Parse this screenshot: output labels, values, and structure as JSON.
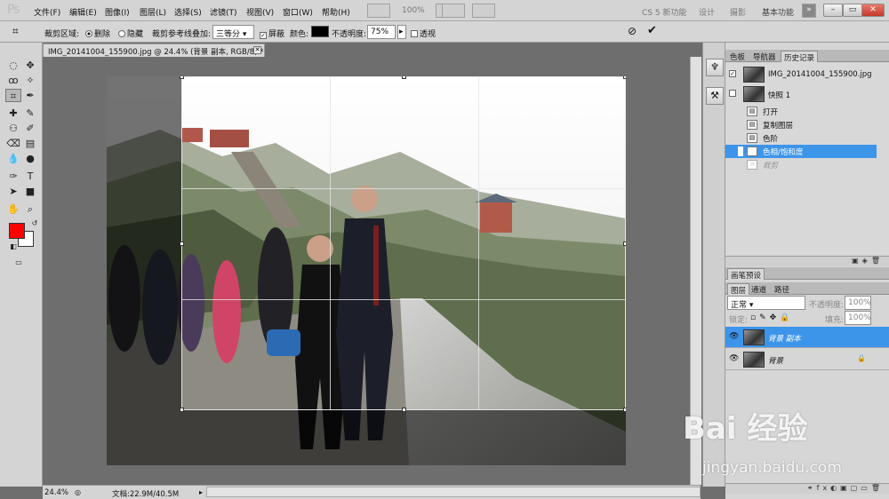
{
  "app": {
    "logo": "Ps"
  },
  "menu": [
    "文件(F)",
    "编辑(E)",
    "图像(I)",
    "图层(L)",
    "选择(S)",
    "滤镜(T)",
    "视图(V)",
    "窗口(W)",
    "帮助(H)"
  ],
  "menubar_extra": {
    "zoom": "100%"
  },
  "workspaces": [
    "CS 5 新功能",
    "设计",
    "摄影",
    "基本功能"
  ],
  "options": {
    "crop_area_label": "裁剪区域:",
    "delete_label": "删除",
    "hide_label": "隐藏",
    "overlay_label": "裁剪参考线叠加:",
    "overlay_value": "三等分",
    "shield_label": "屏蔽",
    "color_label": "颜色:",
    "opacity_label": "不透明度:",
    "opacity_value": "75%",
    "perspective_label": "透视",
    "cancel_icon": "cancel-icon",
    "commit_icon": "commit-icon"
  },
  "document": {
    "tab_title": "IMG_20141004_155900.jpg @ 24.4% (背景 副本, RGB/8) *"
  },
  "colors": {
    "foreground": "#ff0000",
    "background": "#ffffff",
    "selected_row": "#3d95ea"
  },
  "status": {
    "zoom": "24.4%",
    "doc_size": "文档:22.9M/40.5M"
  },
  "panels": {
    "top_tabs": [
      "色板",
      "导航器",
      "历史记录"
    ],
    "history_snapshots": [
      "IMG_20141004_155900.jpg",
      "快照 1"
    ],
    "history_steps": [
      "打开",
      "复制图层",
      "色阶",
      "色相/饱和度",
      "裁剪"
    ],
    "brush_tab": "画笔预设",
    "layer_tabs": [
      "图层",
      "通道",
      "路径"
    ],
    "blend_mode": "正常",
    "opacity_label": "不透明度:",
    "opacity_value": "100%",
    "lock_label": "锁定:",
    "fill_label": "填充:",
    "fill_value": "100%",
    "layers": [
      "背景 副本",
      "背景"
    ]
  },
  "watermark": {
    "logo": "Bai 经验",
    "url": "jingyan.baidu.com"
  }
}
